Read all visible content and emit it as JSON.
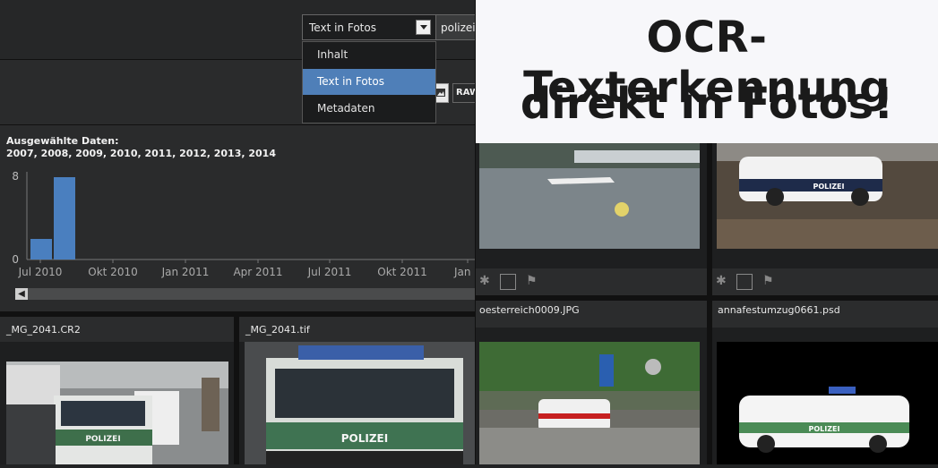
{
  "search": {
    "mode_selected": "Text in Fotos",
    "query": "polizei"
  },
  "dropdown": {
    "options": [
      "Inhalt",
      "Text in Fotos",
      "Metadaten"
    ],
    "selected_index": 1
  },
  "toolbar": {
    "raw_label": "RAW"
  },
  "histogram": {
    "caption_title": "Ausgewählte Daten:",
    "caption_years": "2007, 2008, 2009, 2010, 2011, 2012, 2013, 2014"
  },
  "chart_data": {
    "type": "bar",
    "x_ticks": [
      "Jul 2010",
      "Okt 2010",
      "Jan 2011",
      "Apr 2011",
      "Jul 2011",
      "Okt 2011",
      "Jan 2"
    ],
    "y_ticks": [
      "8",
      "0"
    ],
    "ylim": [
      0,
      8
    ],
    "bars": [
      {
        "x": "2010-06",
        "value": 2
      },
      {
        "x": "2010-07",
        "value": 8
      }
    ],
    "bar_color": "#4a7fbf"
  },
  "thumbnails_left": [
    {
      "filename": "_MG_2041.CR2",
      "plate": "POLIZEI"
    },
    {
      "filename": "_MG_2041.tif",
      "plate": "POLIZEI"
    }
  ],
  "promo": {
    "line1": "OCR-Texterkennung",
    "line2": "direkt in Fotos!"
  },
  "thumbnails_right": [
    {
      "filename": "",
      "plate": ""
    },
    {
      "filename": "",
      "plate": "POLIZEI"
    },
    {
      "filename": "oesterreich0009.JPG",
      "plate": ""
    },
    {
      "filename": "annafestumzug0661.psd",
      "plate": "POLIZEI"
    }
  ],
  "colors": {
    "accent": "#4f7fb8",
    "panel": "#2a2b2c",
    "background": "#222324"
  }
}
